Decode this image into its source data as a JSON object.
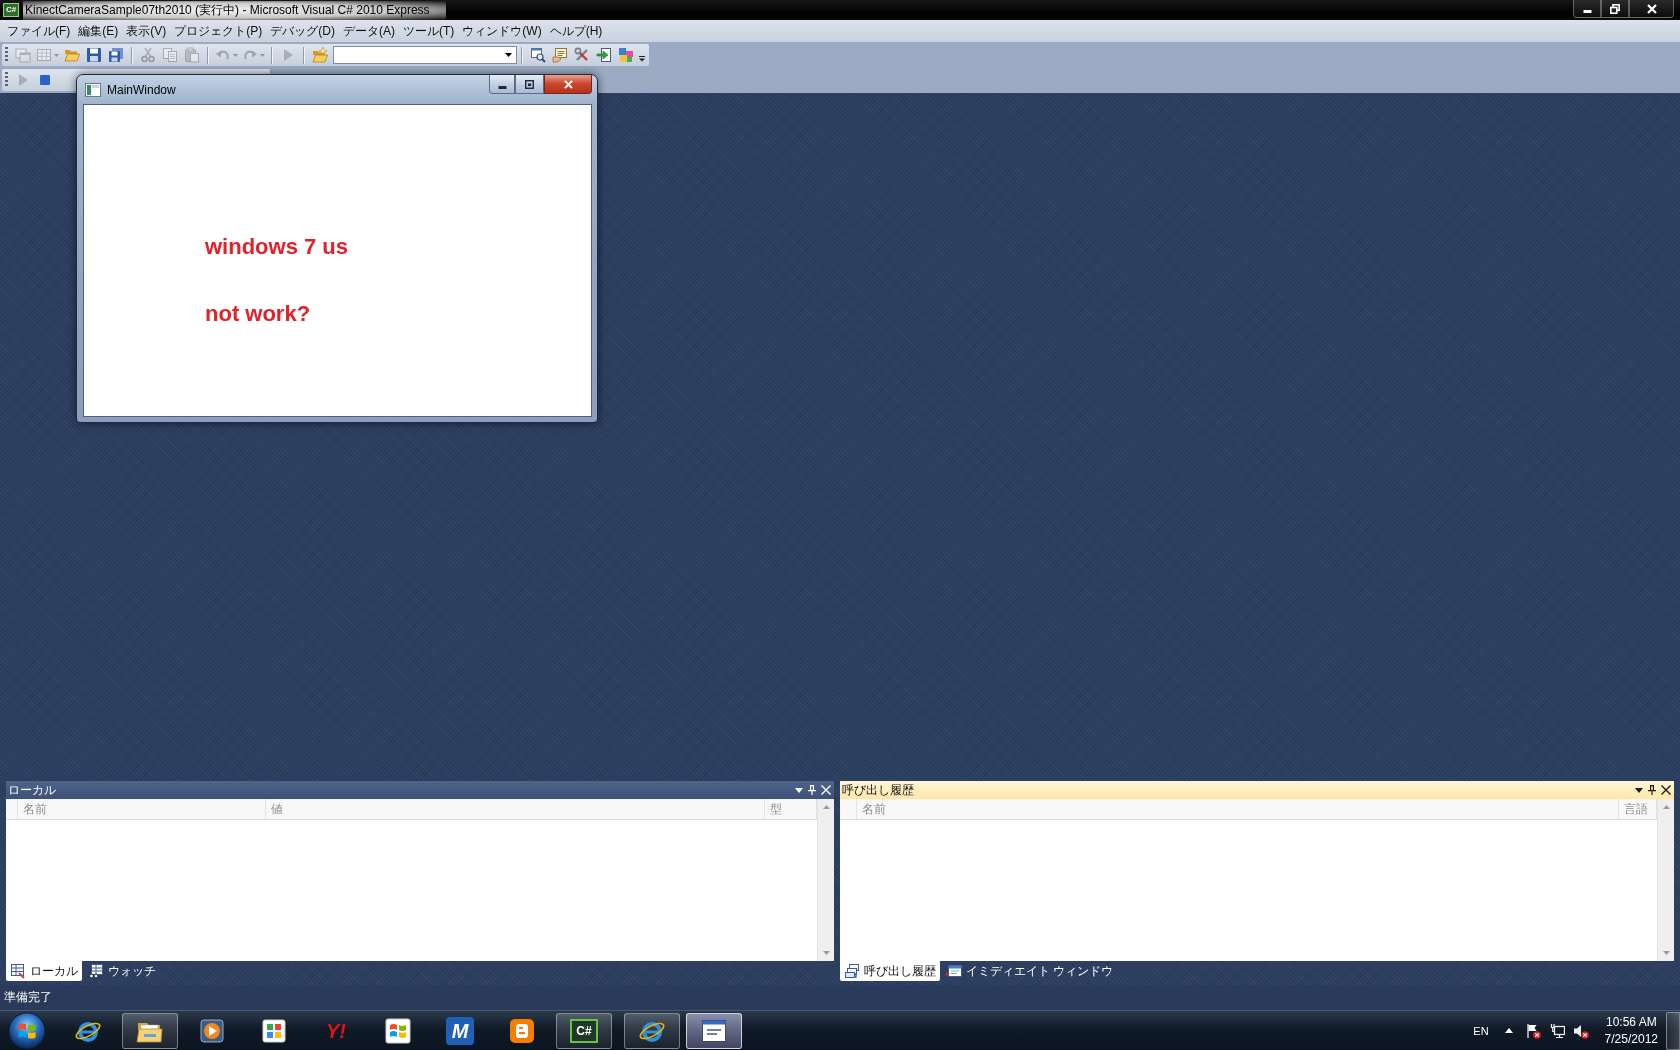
{
  "title_bar": {
    "icon_glyph": "C#",
    "title": "KinectCameraSample07th2010 (実行中) - Microsoft Visual C# 2010 Express",
    "maximized": true
  },
  "menu_bar": {
    "items": [
      "ファイル(F)",
      "編集(E)",
      "表示(V)",
      "プロジェクト(P)",
      "デバッグ(D)",
      "データ(A)",
      "ツール(T)",
      "ウィンドウ(W)",
      "ヘルプ(H)"
    ]
  },
  "toolbars": [
    {
      "overflow": true,
      "groups": [
        [
          {
            "kind": "newproject",
            "disabled": true,
            "dropdown": false
          },
          {
            "kind": "additem",
            "disabled": true,
            "dropdown": true
          },
          {
            "kind": "open",
            "disabled": false,
            "dropdown": false
          },
          {
            "kind": "save",
            "disabled": false,
            "dropdown": false
          },
          {
            "kind": "saveall",
            "disabled": false,
            "dropdown": false
          }
        ],
        [
          {
            "kind": "cut",
            "disabled": true,
            "dropdown": false
          },
          {
            "kind": "copy",
            "disabled": true,
            "dropdown": false
          },
          {
            "kind": "paste",
            "disabled": true,
            "dropdown": false
          }
        ],
        [
          {
            "kind": "undo",
            "disabled": true,
            "dropdown": true
          },
          {
            "kind": "redo",
            "disabled": true,
            "dropdown": true
          }
        ],
        [
          {
            "kind": "start",
            "disabled": true,
            "dropdown": false
          }
        ],
        [
          {
            "kind": "findfiles",
            "disabled": false,
            "dropdown": false
          },
          {
            "kind": "combo",
            "disabled": false,
            "dropdown": true
          }
        ],
        [
          {
            "kind": "find",
            "disabled": false,
            "dropdown": false
          },
          {
            "kind": "properties",
            "disabled": false,
            "dropdown": false
          },
          {
            "kind": "tools",
            "disabled": false,
            "dropdown": false
          },
          {
            "kind": "startpage",
            "disabled": false,
            "dropdown": false
          },
          {
            "kind": "toolbox",
            "disabled": false,
            "dropdown": false
          }
        ]
      ]
    },
    {
      "groups": [
        [
          {
            "kind": "start",
            "disabled": true,
            "dropdown": false
          },
          {
            "kind": "stop",
            "disabled": false,
            "dropdown": false
          }
        ]
      ]
    }
  ],
  "main_window": {
    "title": "MainWindow",
    "maximized": false,
    "lines": [
      "windows 7 us",
      "not work?"
    ]
  },
  "panels": [
    {
      "title": "ローカル",
      "active": false,
      "columns": [
        "名前",
        "値",
        "型"
      ],
      "tabs": [
        {
          "kind": "locals",
          "label": "ローカル",
          "selected": true
        },
        {
          "kind": "watch",
          "label": "ウォッチ",
          "selected": false
        }
      ]
    },
    {
      "title": "呼び出し履歴",
      "active": true,
      "columns": [
        "名前",
        "言語"
      ],
      "tabs": [
        {
          "kind": "callstack",
          "label": "呼び出し履歴",
          "selected": true
        },
        {
          "kind": "immediate",
          "label": "イミディエイト ウィンドウ",
          "selected": false
        }
      ]
    }
  ],
  "status_bar": {
    "text": "準備完了"
  },
  "taskbar": {
    "items": [
      {
        "kind": "ring",
        "running": false,
        "selected": false
      },
      {
        "kind": "folder",
        "running": true,
        "selected": false
      },
      {
        "kind": "player",
        "running": false,
        "selected": false
      },
      {
        "kind": "squares",
        "running": false,
        "selected": false
      },
      {
        "kind": "wordmark",
        "glyph": "Y!",
        "running": false,
        "selected": false
      },
      {
        "kind": "flag",
        "running": false,
        "selected": false
      },
      {
        "kind": "lettertile",
        "glyph": "M",
        "running": false,
        "selected": false
      },
      {
        "kind": "blogtile",
        "running": false,
        "selected": false
      },
      {
        "kind": "codetile",
        "glyph": "C#",
        "running": true,
        "selected": false
      },
      {
        "kind": "ring",
        "running": true,
        "selected": false
      },
      {
        "kind": "window",
        "running": true,
        "selected": true
      }
    ]
  },
  "tray": {
    "language": "EN",
    "icons": [
      {
        "kind": "flag",
        "alert": true
      },
      {
        "kind": "network",
        "alert": false
      },
      {
        "kind": "speaker",
        "alert": true
      }
    ],
    "time": "10:56 AM",
    "date": "7/25/2012"
  }
}
